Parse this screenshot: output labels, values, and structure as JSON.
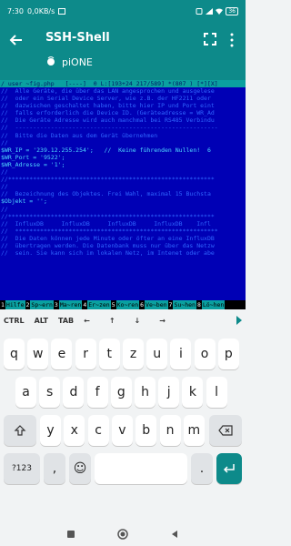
{
  "status": {
    "time": "7:30",
    "speed": "0,0KB/s",
    "battery": "36"
  },
  "appbar": {
    "title": "SSH-Shell",
    "subtitle": "piONE"
  },
  "terminal": {
    "title_line": "/ user ~fig.php   [----]  0 L:[193+24 217/589] *(807 ) [*][X]",
    "lines": [
      {
        "text": "//  Alle Geräte, die über das LAN angesprochen und ausgelese",
        "style": ""
      },
      {
        "text": "//  oder ein Serial Device Server, wie z.B. der HF2211 oder",
        "style": ""
      },
      {
        "text": "//  dazwischen geschaltet haben, bitte hier IP und Port eint",
        "style": ""
      },
      {
        "text": "//  falls erforderlich die Device ID. (Geräteadresse = WR_Ad",
        "style": ""
      },
      {
        "text": "//  Die Geräte Adresse wird auch manchmal bei RS485 Verbindu",
        "style": ""
      },
      {
        "text": "//  ---------------------------------------------------------",
        "style": ""
      },
      {
        "text": "//  Bitte die Daten aus dem Gerät übernehmen",
        "style": ""
      },
      {
        "text": "//",
        "style": ""
      },
      {
        "text": "$WR_IP = '239.12.255.254';   //  Keine führenden Nullen!  6",
        "style": "bright"
      },
      {
        "text": "$WR_Port = '9522';",
        "style": "bright"
      },
      {
        "text": "$WR_Adresse = '1';",
        "style": "bright"
      },
      {
        "text": "//",
        "style": ""
      },
      {
        "text": "//**********************************************************",
        "style": ""
      },
      {
        "text": "//",
        "style": ""
      },
      {
        "text": "//  Bezeichnung des Objektes. Frei Wahl, maximal 15 Buchsta",
        "style": ""
      },
      {
        "text": "$Objekt = '';",
        "style": "bright"
      },
      {
        "text": "//",
        "style": ""
      },
      {
        "text": "//**********************************************************",
        "style": ""
      },
      {
        "text": "//  InfluxDB     InfluxDB     InfluxDB     InfluxDB    Infl",
        "style": ""
      },
      {
        "text": "//  *********************************************************",
        "style": ""
      },
      {
        "text": "//  Die Daten können jede Minute oder öfter an eine InfluxDB",
        "style": ""
      },
      {
        "text": "//  übertragen werden. Die Datenbank muss nur über das Netzw",
        "style": ""
      },
      {
        "text": "//  sein. Sie kann sich im lokalen Netz, im Intenet oder abe",
        "style": ""
      }
    ],
    "fkeys": [
      {
        "num": "1",
        "label": "Hilfe"
      },
      {
        "num": "2",
        "label": "Sp~ern"
      },
      {
        "num": "3",
        "label": "Ma~ren"
      },
      {
        "num": "4",
        "label": "Er~zen"
      },
      {
        "num": "5",
        "label": "Ko~ren"
      },
      {
        "num": "6",
        "label": "Ve~ben"
      },
      {
        "num": "7",
        "label": "Su~hen"
      },
      {
        "num": "8",
        "label": "Lö~hen"
      }
    ]
  },
  "extrakeys": {
    "ctrl": "CTRL",
    "alt": "ALT",
    "tab": "TAB",
    "left": "←",
    "up": "↑",
    "down": "↓",
    "right": "→"
  },
  "keyboard": {
    "row1": [
      "q",
      "w",
      "e",
      "r",
      "t",
      "z",
      "u",
      "i",
      "o",
      "p"
    ],
    "row2": [
      "a",
      "s",
      "d",
      "f",
      "g",
      "h",
      "j",
      "k",
      "l"
    ],
    "row3": [
      "y",
      "x",
      "c",
      "v",
      "b",
      "n",
      "m"
    ],
    "row4": {
      "sym": "?123",
      "comma": ",",
      "emoji": "☺",
      "period": "."
    },
    "colors": {
      "accent": "#0d8a8a",
      "terminal_bg": "#0000b5"
    }
  }
}
